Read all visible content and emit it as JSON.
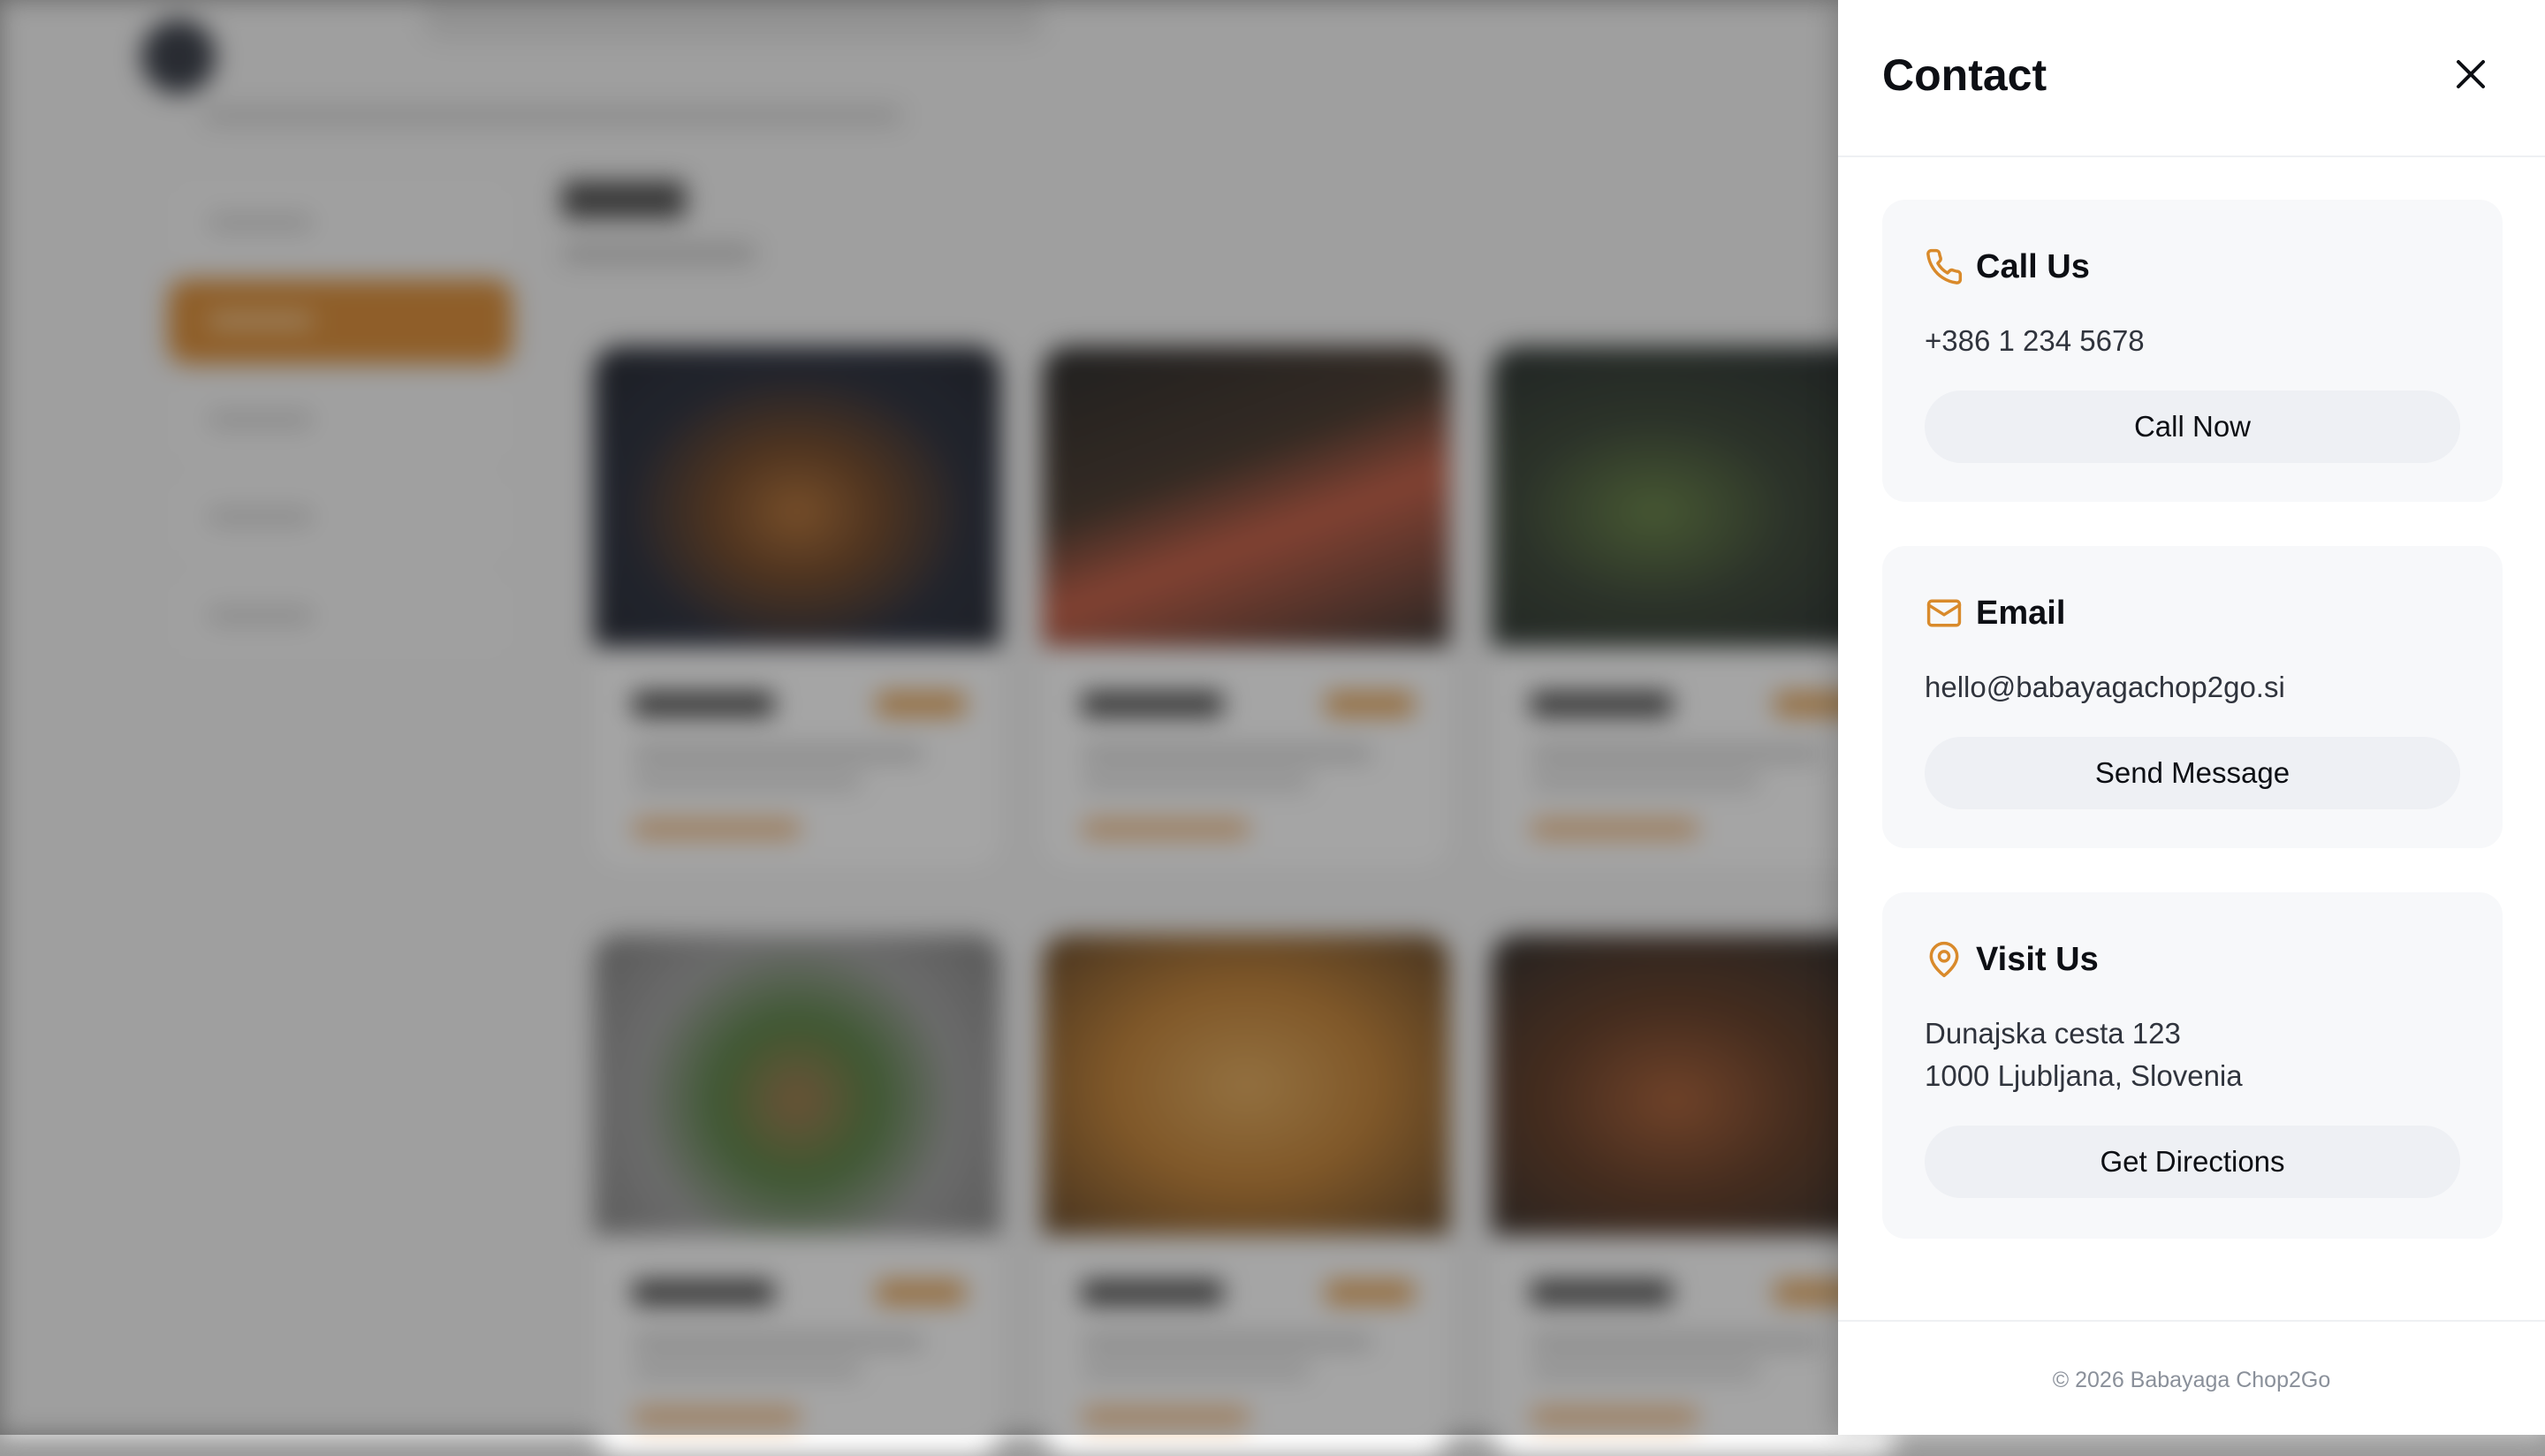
{
  "contact_panel": {
    "title": "Contact",
    "sections": [
      {
        "heading": "Call Us",
        "lines": [
          "+386 1 234 5678"
        ],
        "button": "Call Now",
        "icon": "phone-icon"
      },
      {
        "heading": "Email",
        "lines": [
          "hello@babayagachop2go.si"
        ],
        "button": "Send Message",
        "icon": "mail-icon"
      },
      {
        "heading": "Visit Us",
        "lines": [
          "Dunajska cesta 123",
          "1000 Ljubljana, Slovenia"
        ],
        "button": "Get Directions",
        "icon": "map-pin-icon"
      }
    ],
    "footer": "© 2026 Babayaga Chop2Go"
  },
  "colors": {
    "accent": "#d98a2b",
    "panel_bg": "#ffffff",
    "section_bg": "#f7f8fa",
    "button_bg": "#eef0f4"
  }
}
